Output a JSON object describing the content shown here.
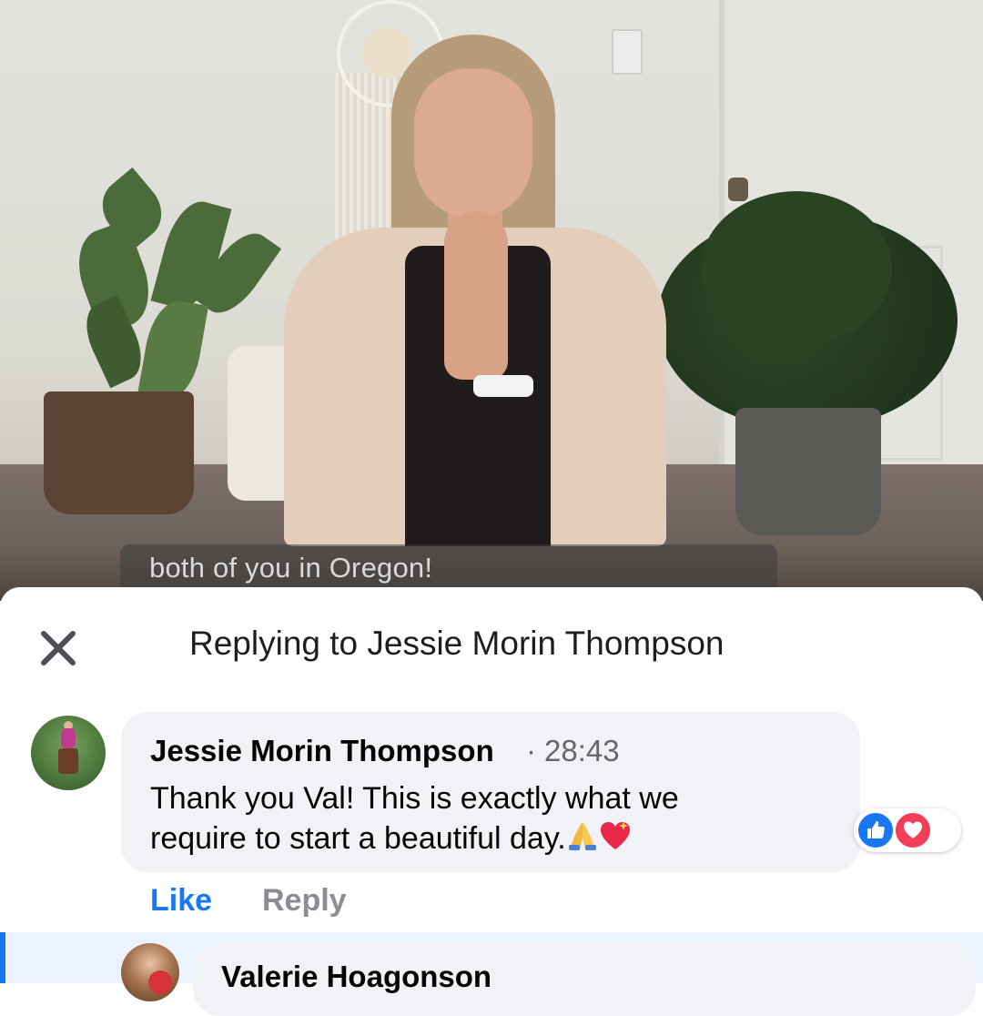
{
  "video": {
    "caption": "both of you in Oregon!"
  },
  "reply_sheet": {
    "title": "Replying to Jessie Morin Thompson",
    "close_icon": "close-icon"
  },
  "comment": {
    "author": "Jessie Morin Thompson",
    "separator": "·",
    "timestamp": "28:43",
    "text_line1": "Thank you Val! This is exactly what we",
    "text_line2": "require to start a beautiful day.",
    "emojis": [
      "folded-hands-emoji",
      "sparkling-heart-emoji"
    ],
    "reactions": [
      "like",
      "love"
    ],
    "actions": {
      "like": "Like",
      "reply": "Reply"
    }
  },
  "next_comment": {
    "author": "Valerie Hoagonson"
  },
  "colors": {
    "accent": "#1877f2",
    "love": "#f33e58",
    "bubble": "#f0f2f5",
    "text": "#050505",
    "muted": "#65676b"
  }
}
